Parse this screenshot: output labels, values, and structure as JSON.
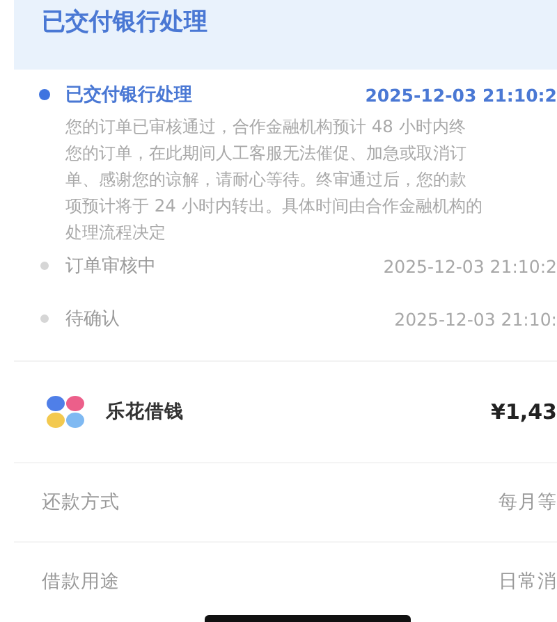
{
  "header": {
    "title": "已交付银行处理"
  },
  "timeline": [
    {
      "title": "已交付银行处理",
      "time": "2025-12-03 21:10:2",
      "selected": true,
      "description_lines": [
        "您的订单已审核通过，合作金融机构预计 48 小时内终",
        "您的订单，在此期间人工客服无法催促、加急或取消订",
        "单、感谢您的谅解，请耐心等待。终审通过后，您的款",
        "项预计将于 24 小时内转出。具体时间由合作金融机构的",
        "处理流程决定"
      ]
    },
    {
      "title": "订单审核中",
      "time": "2025-12-03 21:10:2",
      "selected": false
    },
    {
      "title": "待确认",
      "time": "2025-12-03 21:10:",
      "selected": false
    }
  ],
  "loan": {
    "name": "乐花借钱",
    "amount": "¥1,43"
  },
  "details": [
    {
      "label": "还款方式",
      "value": "每月等"
    },
    {
      "label": "借款用途",
      "value": "日常消"
    }
  ]
}
